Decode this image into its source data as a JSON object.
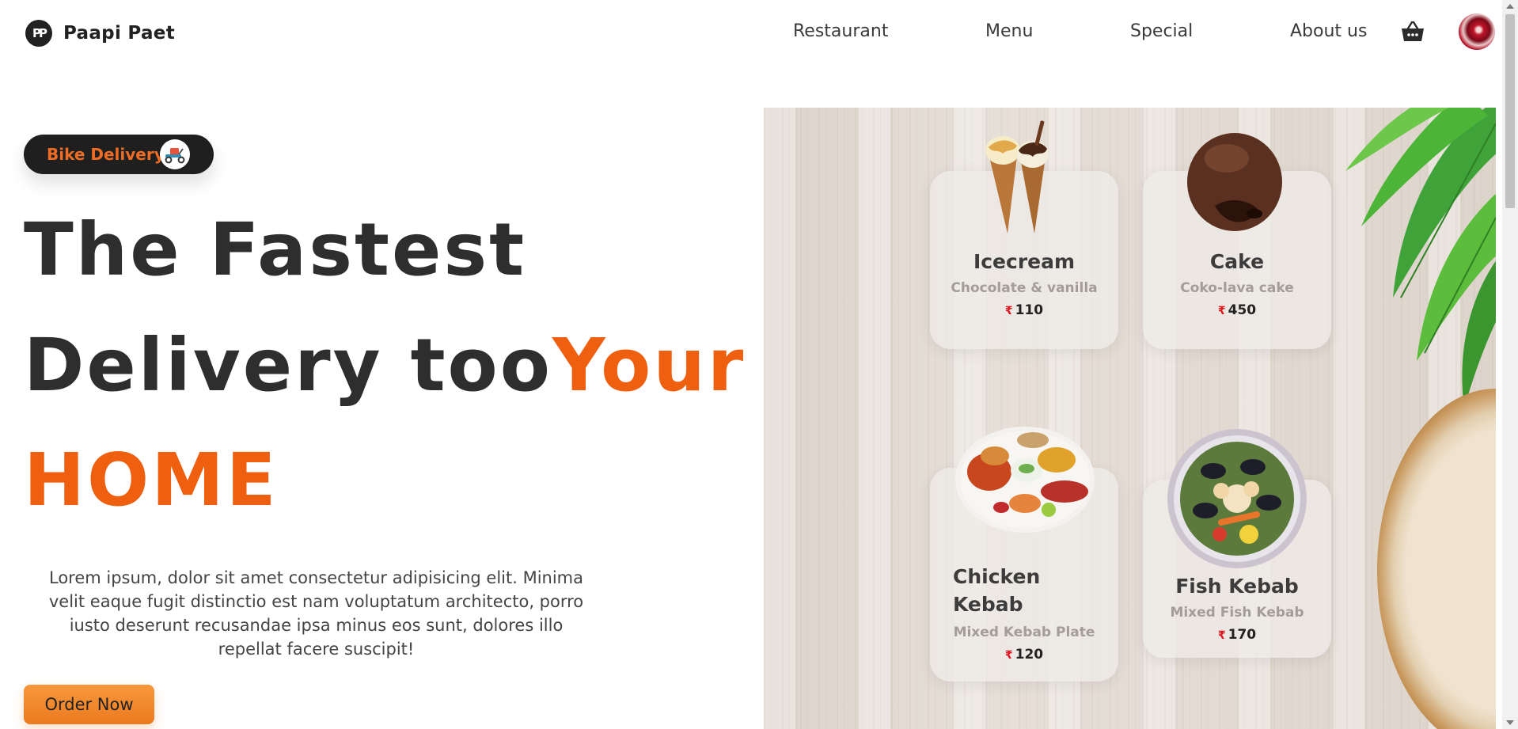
{
  "brand": {
    "name": "Paapi Paet",
    "logo_icon": "pp-monogram-icon"
  },
  "nav": {
    "items": [
      "Restaurant",
      "Menu",
      "Special",
      "About us"
    ],
    "cart_icon": "shopping-basket-icon",
    "avatar_icon": "user-avatar"
  },
  "hero": {
    "badge_label": "Bike Delivery",
    "badge_icon": "scooter-delivery-icon",
    "line1": "The Fastest",
    "line2_dark": "Delivery too",
    "line2_accent": "Your",
    "line3_accent": "HOME",
    "description": "Lorem ipsum, dolor sit amet consectetur adipisicing elit. Minima velit eaque fugit distinctio est nam voluptatum architecto, porro iusto deserunt recusandae ipsa minus eos sunt, dolores illo repellat facere suscipit!",
    "order_button": "Order Now"
  },
  "cards": [
    {
      "title": "Icecream",
      "subtitle": "Chocolate & vanilla",
      "currency": "₹",
      "price": "110",
      "image": "icecream-cones"
    },
    {
      "title": "Cake",
      "subtitle": "Coko-lava cake",
      "currency": "₹",
      "price": "450",
      "image": "lava-cake"
    },
    {
      "title": "Chicken Kebab",
      "subtitle": "Mixed Kebab Plate",
      "currency": "₹",
      "price": "120",
      "image": "kebab-plate"
    },
    {
      "title": "Fish Kebab",
      "subtitle": "Mixed Fish Kebab",
      "currency": "₹",
      "price": "170",
      "image": "fish-kebab-plate"
    }
  ],
  "colors": {
    "accent": "#ee5f10",
    "badge_bg": "#1f1f1f",
    "button": "#f08a2c",
    "text_dark": "#2e2e2e"
  }
}
